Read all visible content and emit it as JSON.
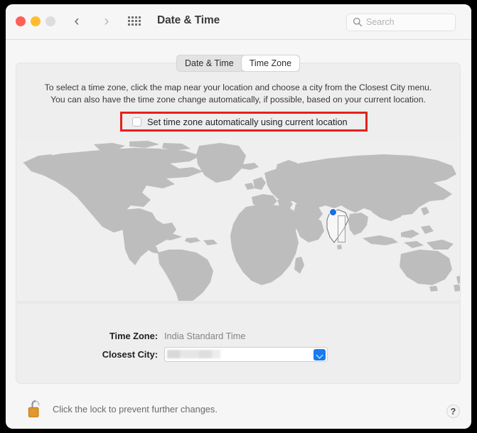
{
  "window": {
    "title": "Date & Time",
    "traffic_lights": [
      {
        "name": "close",
        "color": "#ff5f57"
      },
      {
        "name": "minimize",
        "color": "#ffbd2e"
      },
      {
        "name": "zoom",
        "color": "#dddddd"
      }
    ],
    "nav": {
      "back_icon": "chevron-left",
      "forward_icon": "chevron-right",
      "grid_icon": "show-all-grid"
    }
  },
  "search": {
    "placeholder": "Search",
    "value": "",
    "icon": "search-icon"
  },
  "tabs": [
    {
      "label": "Date & Time",
      "selected": false
    },
    {
      "label": "Time Zone",
      "selected": true
    }
  ],
  "main": {
    "description_line1": "To select a time zone, click the map near your location and choose a city from the Closest City menu.",
    "description_line2": "You can also have the time zone change automatically, if possible, based on your current location.",
    "auto_timezone": {
      "label": "Set time zone automatically using current location",
      "checked": false,
      "highlight_color": "#e8201c"
    },
    "map": {
      "land_color": "#bdbdbd",
      "ocean_color": "#efefef",
      "marker_color": "#1a6fe0",
      "selected_region": "India",
      "marker_label": "current-location-marker",
      "band_label": "timezone-band"
    },
    "fields": [
      {
        "label": "Time Zone:",
        "value": "India Standard Time",
        "type": "text"
      },
      {
        "label": "Closest City:",
        "value": "",
        "type": "popup",
        "redacted": true
      }
    ]
  },
  "footer": {
    "lock_text": "Click the lock to prevent further changes.",
    "lock_icon": "padlock-open-icon",
    "lock_color": "#e8921f",
    "help_label": "?"
  }
}
